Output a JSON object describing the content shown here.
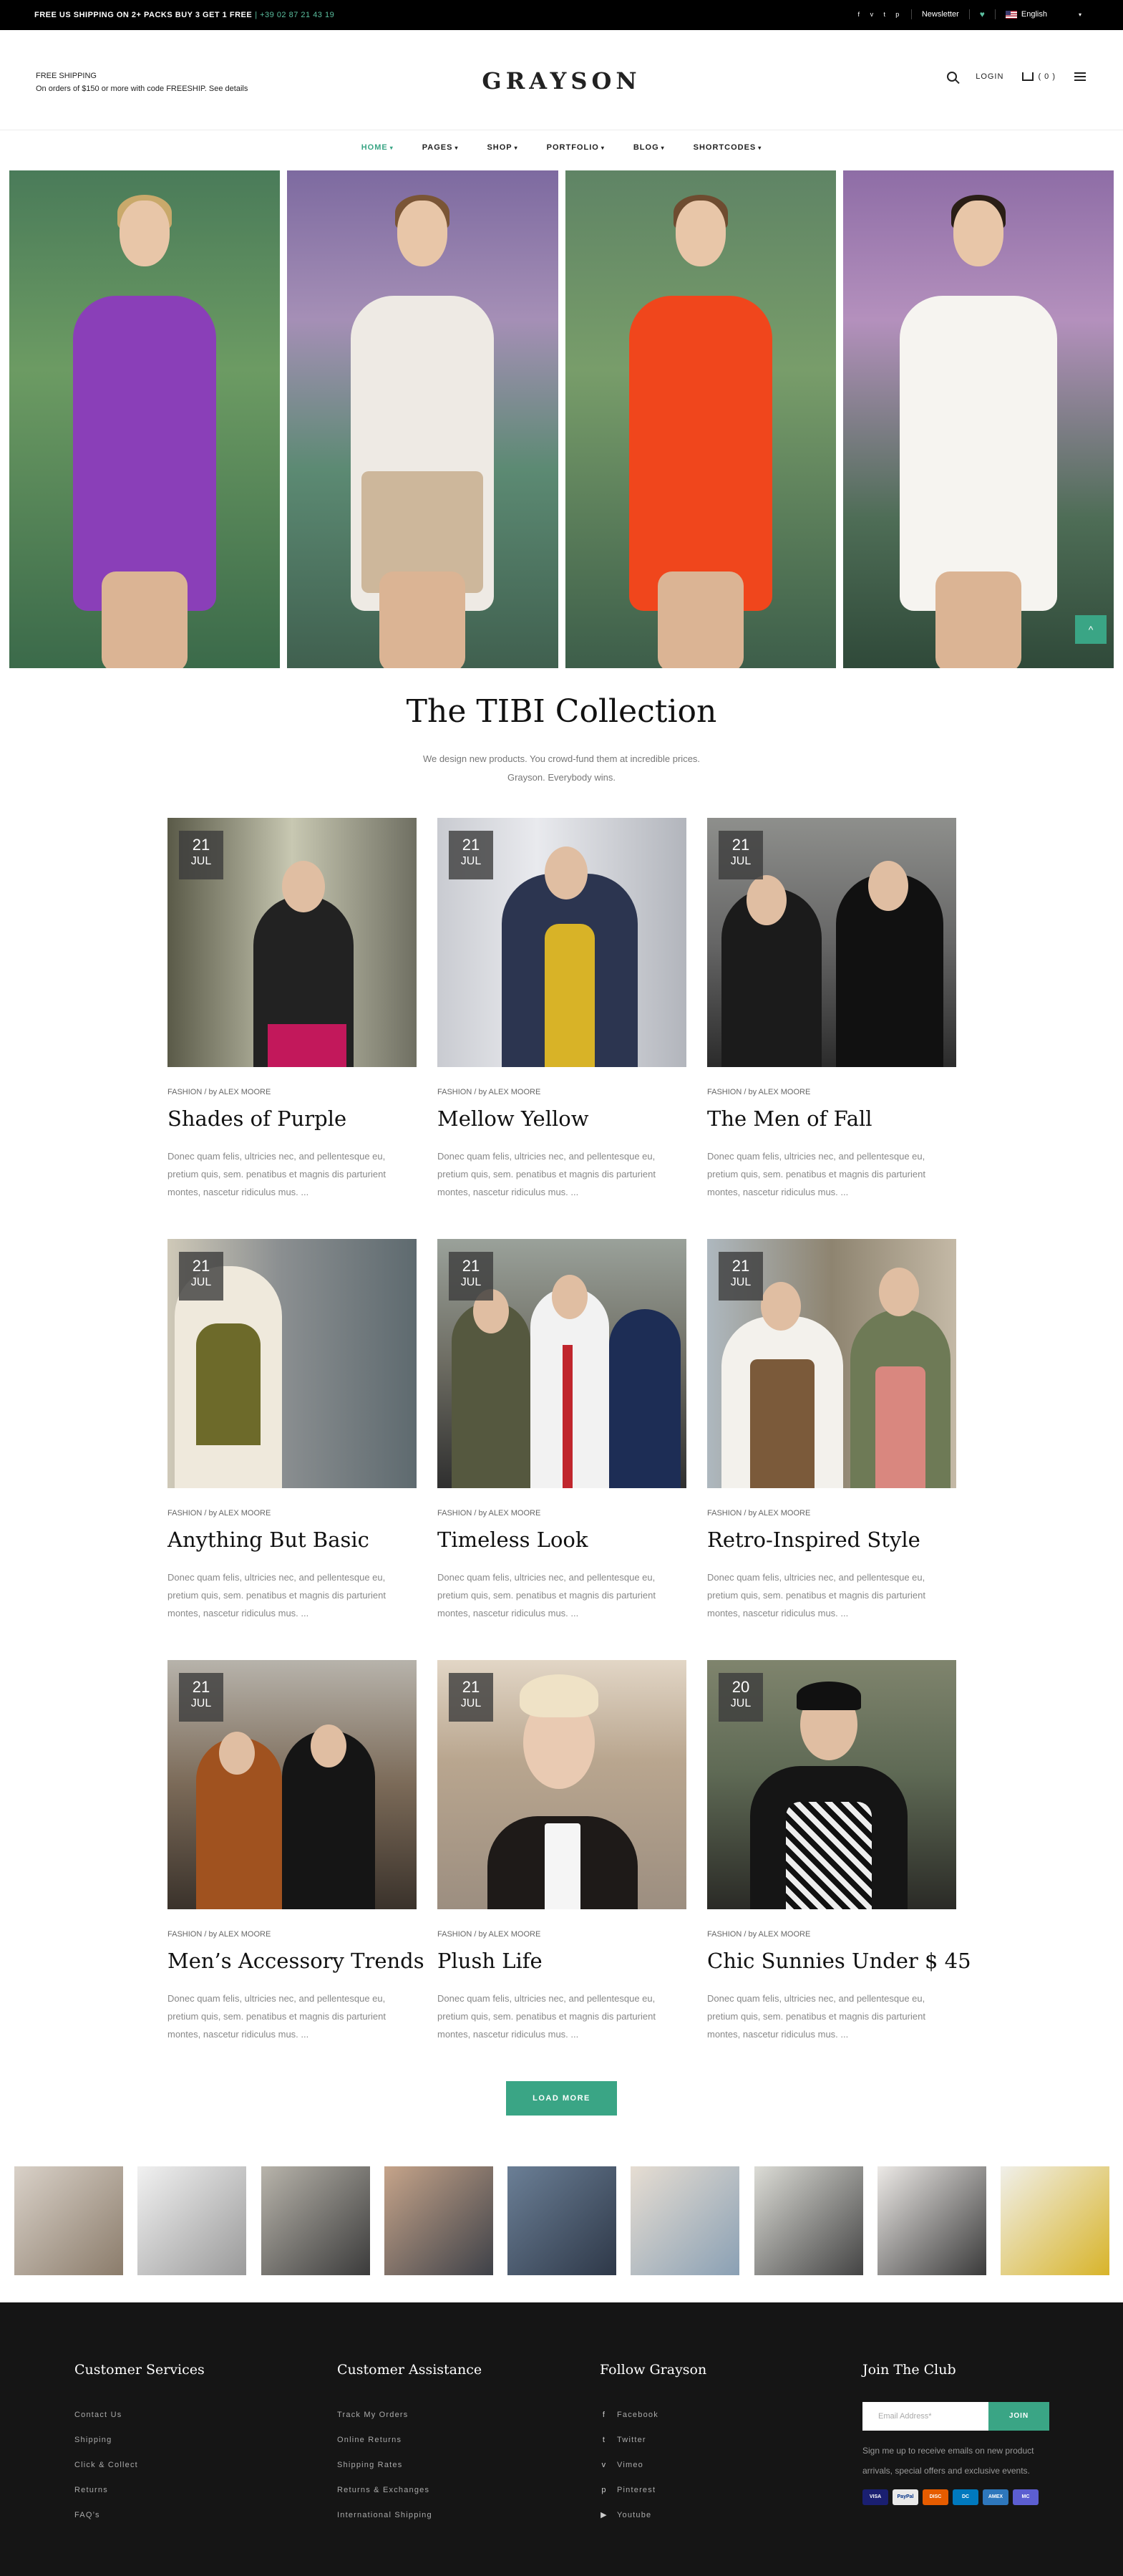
{
  "topbar": {
    "promo": "FREE US SHIPPING ON 2+ PACKS BUY 3 GET 1 FREE",
    "phone": "| +39 02 87 21 43 19",
    "social_icons": [
      "facebook-icon",
      "vimeo-icon",
      "twitter-icon",
      "pinterest-icon"
    ],
    "newsletter": "Newsletter",
    "language": "English"
  },
  "header": {
    "shipping_title": "FREE SHIPPING",
    "shipping_text": "On orders of $150 or more with code FREESHIP. See details",
    "logo": "GRAYSON",
    "login": "LOGIN",
    "cart_count": "( 0 )"
  },
  "nav": {
    "items": [
      {
        "label": "HOME",
        "active": true
      },
      {
        "label": "PAGES"
      },
      {
        "label": "SHOP"
      },
      {
        "label": "PORTFOLIO"
      },
      {
        "label": "BLOG"
      },
      {
        "label": "SHORTCODES"
      }
    ]
  },
  "hero": {
    "to_top": "^"
  },
  "collection": {
    "title": "The TIBI Collection",
    "subtitle_line1": "We design new products. You crowd-fund them at incredible prices.",
    "subtitle_line2": "Grayson. Everybody wins."
  },
  "posts": [
    {
      "day": "21",
      "month": "JUL",
      "category": "FASHION",
      "author": "/ by ALEX MOORE",
      "title": "Shades of Purple",
      "excerpt": "Donec quam felis, ultricies nec, and pellentesque eu, pretium quis, sem. penatibus et magnis dis parturient montes, nascetur ridiculus mus. ..."
    },
    {
      "day": "21",
      "month": "JUL",
      "category": "FASHION",
      "author": "/ by ALEX MOORE",
      "title": "Mellow Yellow",
      "excerpt": "Donec quam felis, ultricies nec, and pellentesque eu, pretium quis, sem. penatibus et magnis dis parturient montes, nascetur ridiculus mus. ..."
    },
    {
      "day": "21",
      "month": "JUL",
      "category": "FASHION",
      "author": "/ by ALEX MOORE",
      "title": "The Men of Fall",
      "excerpt": "Donec quam felis, ultricies nec, and pellentesque eu, pretium quis, sem. penatibus et magnis dis parturient montes, nascetur ridiculus mus. ..."
    },
    {
      "day": "21",
      "month": "JUL",
      "category": "FASHION",
      "author": "/ by ALEX MOORE",
      "title": "Anything But Basic",
      "excerpt": "Donec quam felis, ultricies nec, and pellentesque eu, pretium quis, sem. penatibus et magnis dis parturient montes, nascetur ridiculus mus. ..."
    },
    {
      "day": "21",
      "month": "JUL",
      "category": "FASHION",
      "author": "/ by ALEX MOORE",
      "title": "Timeless Look",
      "excerpt": "Donec quam felis, ultricies nec, and pellentesque eu, pretium quis, sem. penatibus et magnis dis parturient montes, nascetur ridiculus mus. ..."
    },
    {
      "day": "21",
      "month": "JUL",
      "category": "FASHION",
      "author": "/ by ALEX MOORE",
      "title": "Retro-Inspired Style",
      "excerpt": "Donec quam felis, ultricies nec, and pellentesque eu, pretium quis, sem. penatibus et magnis dis parturient montes, nascetur ridiculus mus. ..."
    },
    {
      "day": "21",
      "month": "JUL",
      "category": "FASHION",
      "author": "/ by ALEX MOORE",
      "title": "Men’s Accessory Trends",
      "excerpt": "Donec quam felis, ultricies nec, and pellentesque eu, pretium quis, sem. penatibus et magnis dis parturient montes, nascetur ridiculus mus. ..."
    },
    {
      "day": "21",
      "month": "JUL",
      "category": "FASHION",
      "author": "/ by ALEX MOORE",
      "title": "Plush Life",
      "excerpt": "Donec quam felis, ultricies nec, and pellentesque eu, pretium quis, sem. penatibus et magnis dis parturient montes, nascetur ridiculus mus. ..."
    },
    {
      "day": "20",
      "month": "JUL",
      "category": "FASHION",
      "author": "/ by ALEX MOORE",
      "title": "Chic Sunnies Under $ 45",
      "excerpt": "Donec quam felis, ultricies nec, and pellentesque eu, pretium quis, sem. penatibus et magnis dis parturient montes, nascetur ridiculus mus. ..."
    }
  ],
  "load_more": "LOAD MORE",
  "footer": {
    "col1": {
      "title": "Customer Services",
      "items": [
        "Contact Us",
        "Shipping",
        "Click & Collect",
        "Returns",
        "FAQ’s"
      ]
    },
    "col2": {
      "title": "Customer Assistance",
      "items": [
        "Track My Orders",
        "Online Returns",
        "Shipping Rates",
        "Returns & Exchanges",
        "International Shipping"
      ]
    },
    "col3": {
      "title": "Follow Grayson",
      "items": [
        {
          "icon": "facebook-icon",
          "glyph": "f",
          "label": "Facebook"
        },
        {
          "icon": "twitter-icon",
          "glyph": "t",
          "label": "Twitter"
        },
        {
          "icon": "vimeo-icon",
          "glyph": "v",
          "label": "Vimeo"
        },
        {
          "icon": "pinterest-icon",
          "glyph": "p",
          "label": "Pinterest"
        },
        {
          "icon": "youtube-icon",
          "glyph": "▶",
          "label": "Youtube"
        }
      ]
    },
    "col4": {
      "title": "Join The Club",
      "email_placeholder": "Email Address*",
      "join_button": "JOIN",
      "text": "Sign me up to receive emails on new product arrivals, special offers and exclusive events.",
      "payments": [
        {
          "name": "VISA",
          "color": "#1a1f71"
        },
        {
          "name": "PayPal",
          "color": "#e9e9e9"
        },
        {
          "name": "DISC",
          "color": "#e65c00"
        },
        {
          "name": "DC",
          "color": "#0079be"
        },
        {
          "name": "AMEX",
          "color": "#2e77bc"
        },
        {
          "name": "MC",
          "color": "#5c5ed1"
        }
      ]
    }
  }
}
